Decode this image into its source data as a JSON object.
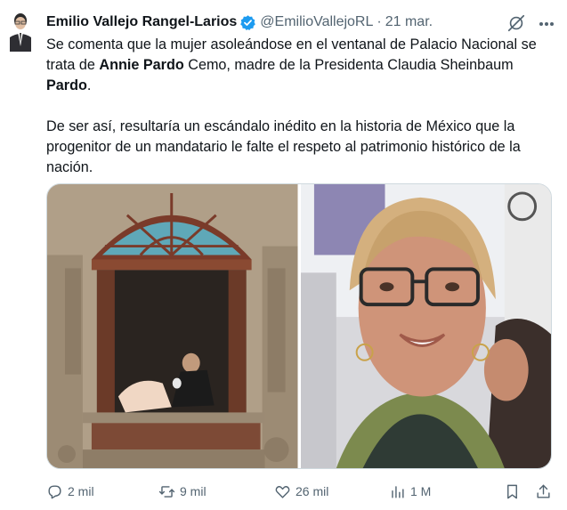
{
  "colors": {
    "verified_blue": "#1d9bf0",
    "text_primary": "#0f1419",
    "text_secondary": "#536471",
    "border": "#cfd9de"
  },
  "tweet": {
    "author": {
      "name": "Emilio Vallejo Rangel-Larios",
      "handle": "@EmilioVallejoRL",
      "separator": "·",
      "date": "21 mar.",
      "verified": true
    },
    "text": {
      "p1_a": "Se comenta que la mujer asoleándose en el ventanal de Palacio Nacional se trata de ",
      "p1_b": "Annie Pardo",
      "p1_c": " Cemo, madre de la Presidenta Claudia Sheinbaum ",
      "p1_d": "Pardo",
      "p1_e": ".",
      "p2": "De ser así, resultaría un escándalo inédito en la historia de México que la progenitor de un mandatario le falte el respeto al patrimonio histórico de la nación."
    },
    "media": [
      {
        "icon": "photo-window-woman"
      },
      {
        "icon": "photo-portrait-woman"
      }
    ],
    "actions": {
      "replies": "2 mil",
      "reposts": "9 mil",
      "likes": "26 mil",
      "views": "1 M"
    },
    "icons": [
      "grok-icon",
      "more-icon",
      "reply-icon",
      "repost-icon",
      "like-icon",
      "views-icon",
      "bookmark-icon",
      "share-icon"
    ]
  }
}
